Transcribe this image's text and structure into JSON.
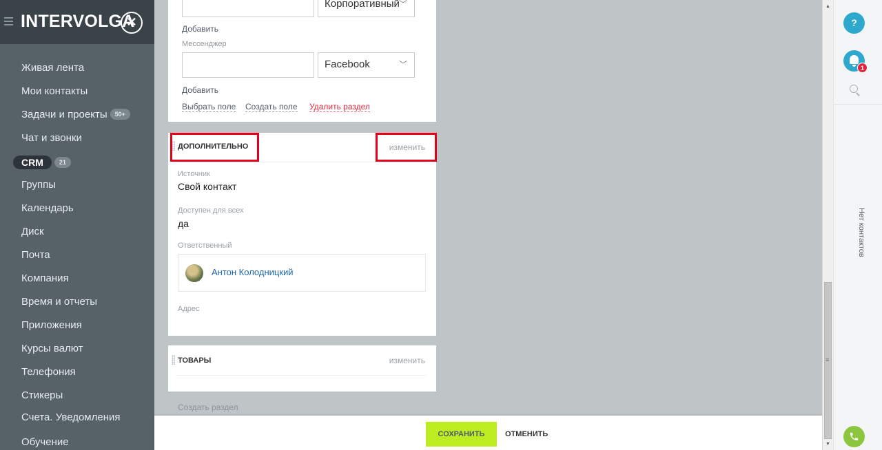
{
  "sidebar": {
    "logo": "INTERVOLGA",
    "items": [
      {
        "label": "Живая лента"
      },
      {
        "label": "Мои контакты"
      },
      {
        "label": "Задачи и проекты",
        "counter": "50+"
      },
      {
        "label": "Чат и звонки"
      },
      {
        "label": "CRM",
        "counter": "21"
      },
      {
        "label": "Группы"
      },
      {
        "label": "Календарь"
      },
      {
        "label": "Диск"
      },
      {
        "label": "Почта"
      },
      {
        "label": "Компания"
      },
      {
        "label": "Время и отчеты"
      },
      {
        "label": "Приложения"
      },
      {
        "label": "Курсы валют"
      },
      {
        "label": "Телефония"
      },
      {
        "label": "Стикеры"
      },
      {
        "label": "Счета. Уведомления"
      },
      {
        "label": "Обучение"
      }
    ]
  },
  "contact_section": {
    "phone_type_select": "Корпоративный",
    "add_link_1": "Добавить",
    "messenger_label": "Мессенджер",
    "messenger_input": "",
    "messenger_select": "Facebook",
    "add_link_2": "Добавить",
    "choose_field": "Выбрать поле",
    "create_field": "Создать поле",
    "delete_section": "Удалить раздел"
  },
  "extra_section": {
    "title": "ДОПОЛНИТЕЛЬНО",
    "edit": "изменить",
    "source_label": "Источник",
    "source_value": "Свой контакт",
    "available_label": "Доступен для всех",
    "available_value": "да",
    "responsible_label": "Ответственный",
    "responsible_name": "Антон Колодницкий",
    "address_label": "Адрес"
  },
  "goods_section": {
    "title": "ТОВАРЫ",
    "edit": "изменить"
  },
  "create_section": "Создать раздел",
  "footer": {
    "save": "СОХРАНИТЬ",
    "cancel": "ОТМЕНИТЬ"
  },
  "right_panel": {
    "help": "?",
    "notifications_count": "1",
    "no_contacts": "Нет контактов"
  },
  "colors": {
    "sidebar_bg": "#566168",
    "accent_blue": "#2fa8ce",
    "save_green": "#bbed21",
    "highlight_red": "#e2001a",
    "link_red": "#e0273d"
  }
}
